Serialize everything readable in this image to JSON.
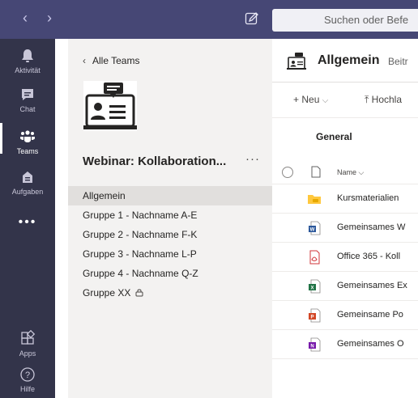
{
  "topbar": {
    "back_arrow": "‹",
    "forward_arrow": "›",
    "search_placeholder": "Suchen oder Befe"
  },
  "rail": {
    "items": [
      {
        "label": "Aktivität",
        "icon": "bell-icon"
      },
      {
        "label": "Chat",
        "icon": "chat-icon"
      },
      {
        "label": "Teams",
        "icon": "teams-icon"
      },
      {
        "label": "Aufgaben",
        "icon": "assignments-icon"
      },
      {
        "label": "Apps",
        "icon": "apps-icon"
      },
      {
        "label": "Hilfe",
        "icon": "help-icon"
      }
    ],
    "more": "•••",
    "active": "Teams"
  },
  "panel": {
    "back_label": "Alle Teams",
    "team_name": "Webinar: Kollaboration...",
    "more": "···",
    "channels": [
      {
        "label": "Allgemein",
        "selected": true
      },
      {
        "label": "Gruppe 1 - Nachname A-E"
      },
      {
        "label": "Gruppe 2 - Nachname F-K"
      },
      {
        "label": "Gruppe 3 - Nachname L-P"
      },
      {
        "label": "Gruppe 4 - Nachname Q-Z"
      },
      {
        "label": "Gruppe XX",
        "private": true
      }
    ]
  },
  "main": {
    "channel_title": "Allgemein",
    "tab_label": "Beitr",
    "toolbar": {
      "new_label": "Neu",
      "upload_label": "Hochla"
    },
    "section_title": "General",
    "name_column": "Name",
    "files": [
      {
        "name": "Kursmaterialien",
        "type": "folder"
      },
      {
        "name": "Gemeinsames W",
        "type": "word"
      },
      {
        "name": "Office 365 - Koll",
        "type": "pdf"
      },
      {
        "name": "Gemeinsames Ex",
        "type": "excel"
      },
      {
        "name": "Gemeinsame Po",
        "type": "powerpoint"
      },
      {
        "name": "Gemeinsames O",
        "type": "onenote"
      }
    ]
  },
  "colors": {
    "topbar": "#464775",
    "rail": "#33344a",
    "panel": "#f3f2f1",
    "selected_channel": "#e1dfdd",
    "word": "#2b579a",
    "excel": "#217346",
    "powerpoint": "#d24726",
    "onenote": "#7719aa",
    "pdf": "#d13438",
    "folder": "#ffc83d"
  }
}
